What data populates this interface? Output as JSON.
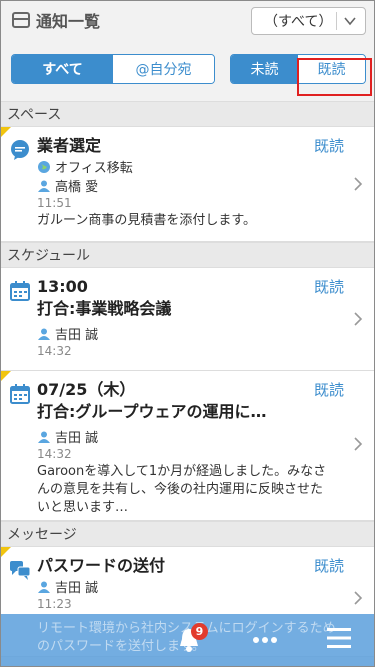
{
  "header": {
    "title": "通知一覧",
    "filter_value": "（すべて）"
  },
  "tabs_left": [
    "すべて",
    "@自分宛"
  ],
  "tabs_right": [
    "未読",
    "既読"
  ],
  "sections": {
    "space": "スペース",
    "schedule": "スケジュール",
    "message": "メッセージ"
  },
  "items": {
    "space1": {
      "read_label": "既読",
      "title": "業者選定",
      "space_name": "オフィス移転",
      "user": "高橋 愛",
      "time": "11:51",
      "body": "ガルーン商事の見積書を添付します。"
    },
    "sched1": {
      "read_label": "既読",
      "time_title": "13:00",
      "title": "打合:事業戦略会議",
      "user": "吉田 誠",
      "time": "14:32"
    },
    "sched2": {
      "read_label": "既読",
      "time_title": "07/25（木）",
      "title": "打合:グループウェアの運用に…",
      "user": "吉田 誠",
      "time": "14:32",
      "body": "Garoonを導入して1か月が経過しました。みなさんの意見を共有し、今後の社内運用に反映させたいと思います…"
    },
    "msg1": {
      "read_label": "既読",
      "title": "パスワードの送付",
      "user": "吉田 誠",
      "time": "11:23",
      "body": "リモート環境から社内システムにログインするためのパスワードを送付します。"
    }
  },
  "bottom": {
    "badge_count": "9"
  },
  "colors": {
    "accent": "#3c8dcd",
    "highlight": "#e02020",
    "corner": "#f1c40f"
  }
}
